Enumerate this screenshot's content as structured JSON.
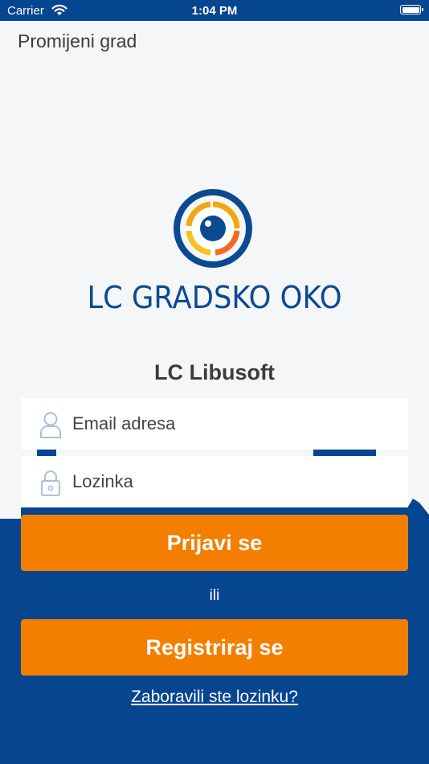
{
  "status_bar": {
    "carrier": "Carrier",
    "time": "1:04 PM"
  },
  "header": {
    "change_city": "Promijeni grad"
  },
  "logo": {
    "text": "LC GRADSKO OKO"
  },
  "organization": {
    "name": "LC Libusoft"
  },
  "form": {
    "email_placeholder": "Email adresa",
    "password_placeholder": "Lozinka",
    "login_label": "Prijavi se",
    "or_label": "ili",
    "register_label": "Registriraj se",
    "forgot_label": "Zaboravili ste lozinku?"
  },
  "colors": {
    "brand_blue": "#064590",
    "accent_orange": "#f47e00"
  },
  "icons": [
    "wifi-icon",
    "battery-icon",
    "user-icon",
    "lock-icon"
  ]
}
